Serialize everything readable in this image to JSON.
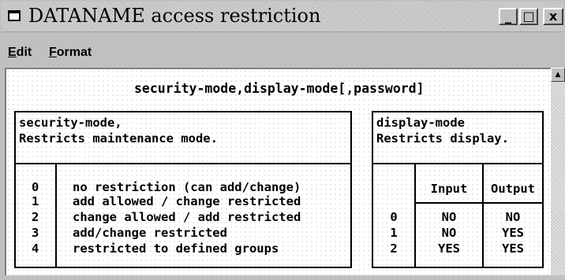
{
  "window": {
    "title": "DATANAME access restriction",
    "icon": "window-icon",
    "buttons": {
      "minimize": "_",
      "maximize": "□",
      "close": "x"
    }
  },
  "menu": {
    "items": [
      {
        "label": "Edit"
      },
      {
        "label": "Format"
      }
    ]
  },
  "syntax_line": "security-mode,display-mode[,password]",
  "security_box": {
    "header": [
      "security-mode,",
      "Restricts maintenance mode."
    ],
    "rows": [
      {
        "code": "0",
        "desc": "no restriction (can add/change)"
      },
      {
        "code": "1",
        "desc": "add allowed / change restricted"
      },
      {
        "code": "2",
        "desc": "change allowed / add restricted"
      },
      {
        "code": "3",
        "desc": "add/change restricted"
      },
      {
        "code": "4",
        "desc": "restricted to defined groups"
      }
    ]
  },
  "display_box": {
    "header": [
      "display-mode",
      "Restricts display."
    ],
    "columns": [
      "Input",
      "Output"
    ],
    "rows": [
      {
        "code": "0",
        "input": "NO",
        "output": "NO"
      },
      {
        "code": "1",
        "input": "NO",
        "output": "YES"
      },
      {
        "code": "2",
        "input": "YES",
        "output": "YES"
      }
    ]
  },
  "scrollbar": {
    "up_arrow": "▲"
  }
}
